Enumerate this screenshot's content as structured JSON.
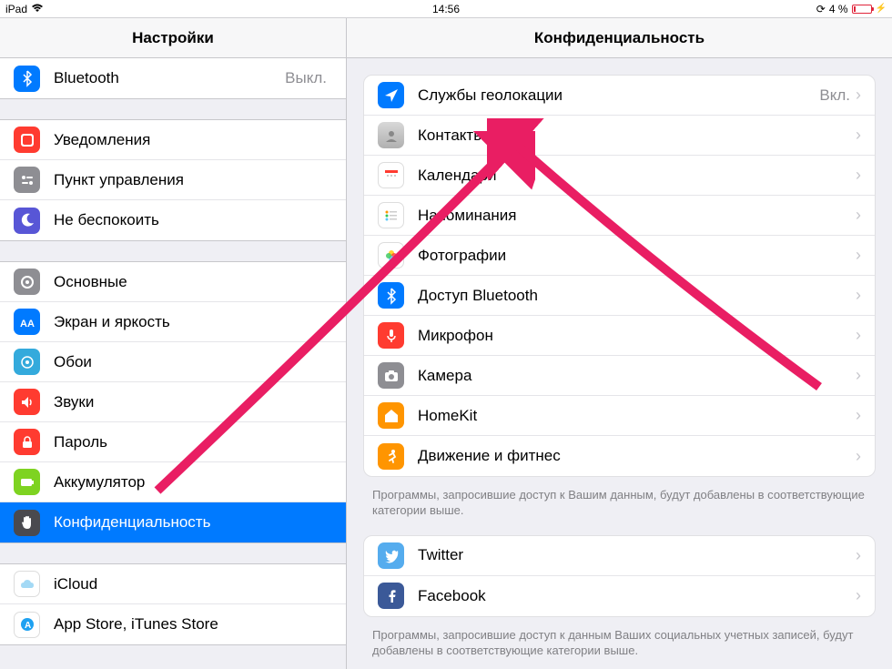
{
  "status": {
    "device": "iPad",
    "time": "14:56",
    "battery": "4 %"
  },
  "header": {
    "left": "Настройки",
    "right": "Конфиденциальность"
  },
  "sidebar": {
    "g0": [
      {
        "label": "Bluetooth",
        "value": "Выкл."
      }
    ],
    "g1": [
      {
        "label": "Уведомления"
      },
      {
        "label": "Пункт управления"
      },
      {
        "label": "Не беспокоить"
      }
    ],
    "g2": [
      {
        "label": "Основные"
      },
      {
        "label": "Экран и яркость"
      },
      {
        "label": "Обои"
      },
      {
        "label": "Звуки"
      },
      {
        "label": "Пароль"
      },
      {
        "label": "Аккумулятор"
      },
      {
        "label": "Конфиденциальность"
      }
    ],
    "g3": [
      {
        "label": "iCloud"
      },
      {
        "label": "App Store, iTunes Store"
      }
    ]
  },
  "detail": {
    "g0": [
      {
        "label": "Службы геолокации",
        "value": "Вкл."
      },
      {
        "label": "Контакты"
      },
      {
        "label": "Календари"
      },
      {
        "label": "Напоминания"
      },
      {
        "label": "Фотографии"
      },
      {
        "label": "Доступ Bluetooth"
      },
      {
        "label": "Микрофон"
      },
      {
        "label": "Камера"
      },
      {
        "label": "HomeKit"
      },
      {
        "label": "Движение и фитнес"
      }
    ],
    "footer0": "Программы, запросившие доступ к Вашим данным, будут добавлены в соответствующие категории выше.",
    "g1": [
      {
        "label": "Twitter"
      },
      {
        "label": "Facebook"
      }
    ],
    "footer1": "Программы, запросившие доступ к данным Ваших социальных учетных записей, будут добавлены в соответствующие категории выше."
  }
}
